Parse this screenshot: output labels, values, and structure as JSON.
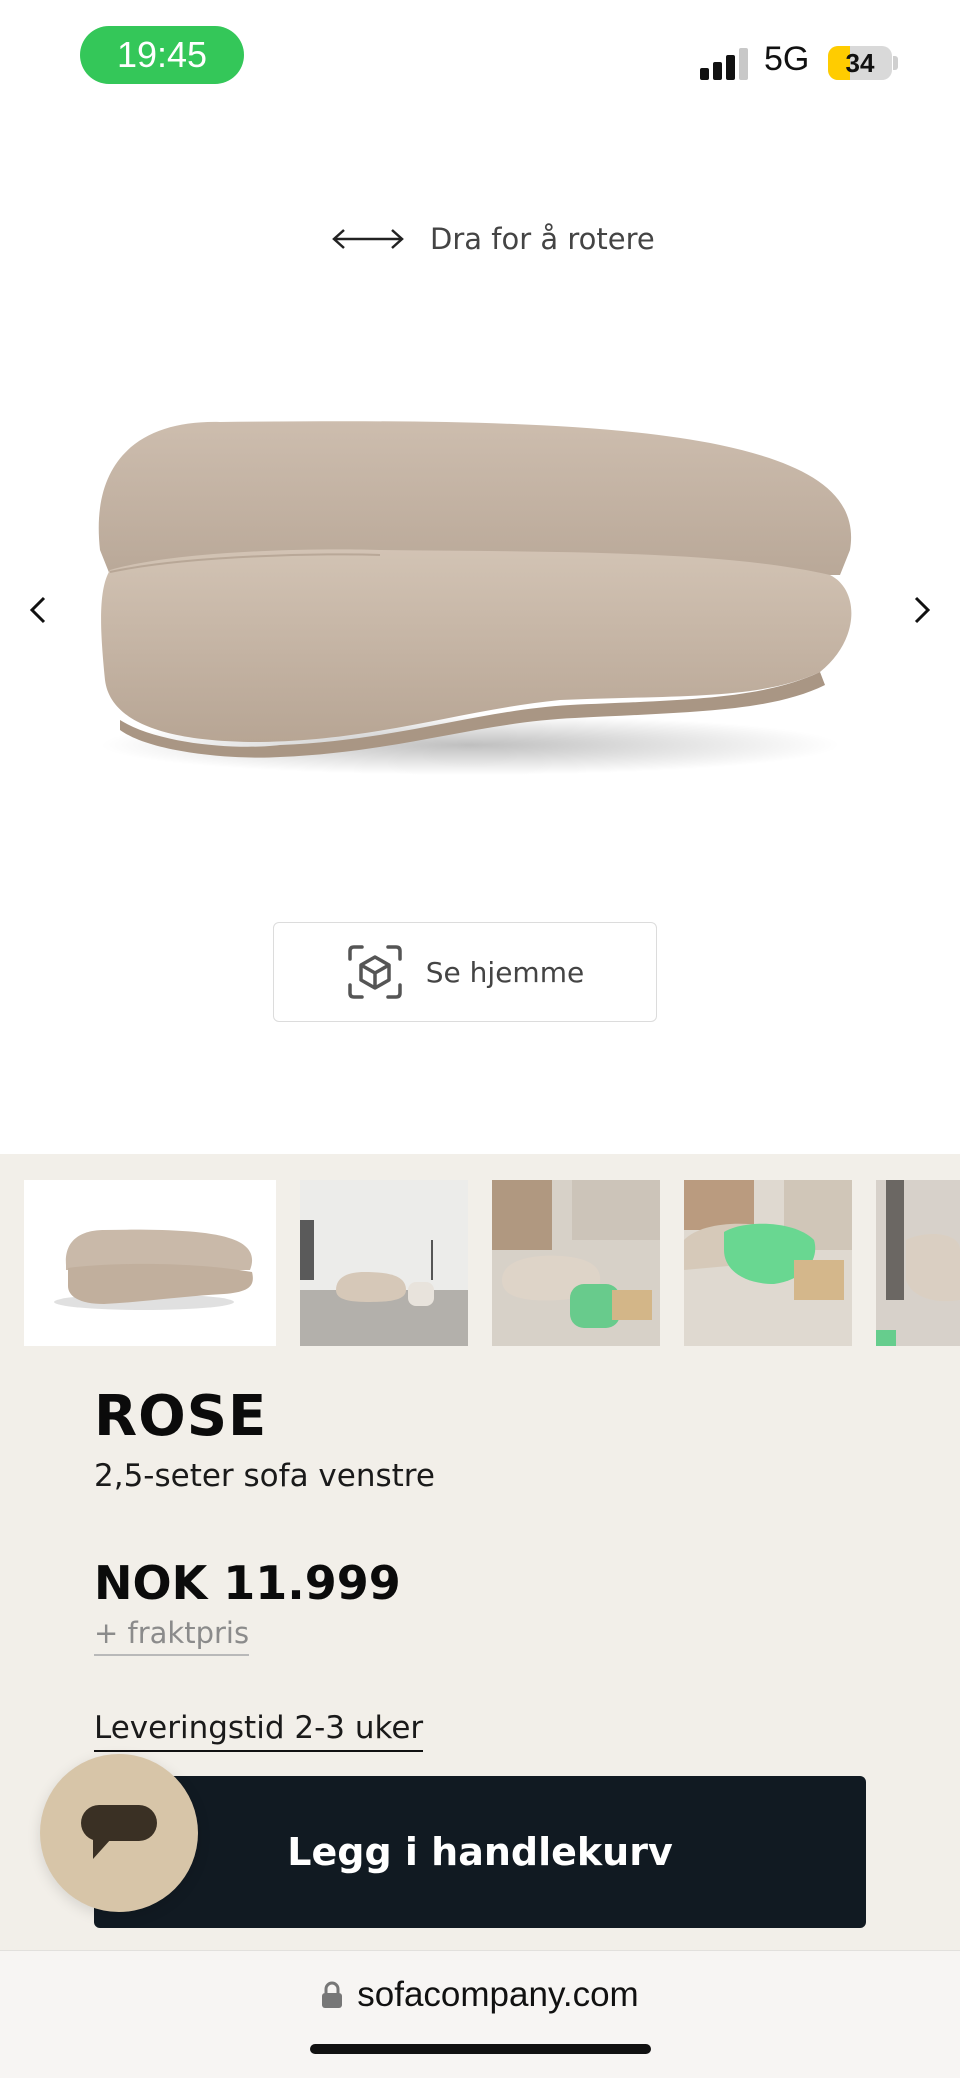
{
  "status_bar": {
    "time": "19:45",
    "network": "5G",
    "battery": "34",
    "battery_level": 0.34
  },
  "viewer": {
    "rotate_hint": "Dra for å rotere",
    "ar_button_label": "Se hjemme",
    "prev_icon": "chevron-left-icon",
    "next_icon": "chevron-right-icon"
  },
  "gallery": {
    "thumbnails": [
      "sofa-studio-photo",
      "sofa-room-photo",
      "sofa-living-room-photo-1",
      "sofa-living-room-photo-2",
      "sofa-living-room-photo-3"
    ]
  },
  "product": {
    "title": "ROSE",
    "subtitle": "2,5-seter sofa venstre",
    "price": "NOK 11.999",
    "shipping_link": "+ fraktpris",
    "delivery_link": "Leveringstid 2-3 uker",
    "add_to_cart_label": "Legg i handlekurv"
  },
  "chat": {
    "icon": "chat-icon"
  },
  "browser": {
    "url": "sofacompany.com",
    "lock_icon": "lock-icon"
  },
  "colors": {
    "panel_bg": "#f2efe9",
    "cta_bg": "#111a22",
    "chat_bg": "#d7c5a8",
    "time_pill": "#34c759"
  }
}
